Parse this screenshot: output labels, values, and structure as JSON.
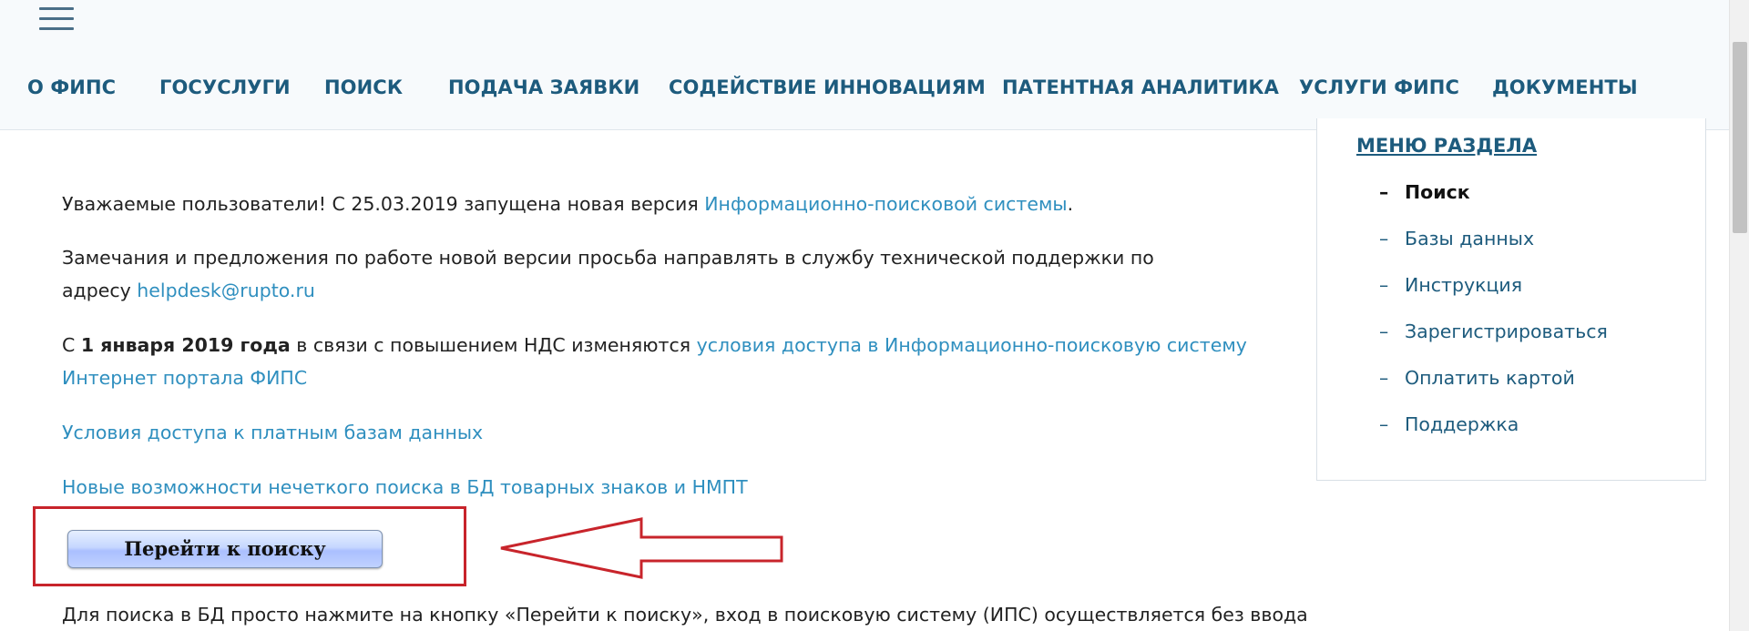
{
  "header": {
    "nav": [
      "О ФИПС",
      "ГОСУСЛУГИ",
      "ПОИСК",
      "ПОДАЧА ЗАЯВКИ",
      "СОДЕЙСТВИЕ ИННОВАЦИЯМ",
      "ПАТЕНТНАЯ АНАЛИТИКА",
      "УСЛУГИ ФИПС",
      "ДОКУМЕНТЫ"
    ]
  },
  "content": {
    "p1_text": "Уважаемые пользователи! С 25.03.2019 запущена новая версия ",
    "p1_link": "Информационно-поисковой системы",
    "p1_end": ".",
    "p2_line1": "Замечания и предложения по работе новой версии просьба направлять в службу технической поддержки по",
    "p2_line2_text": "адресу ",
    "p2_link": "helpdesk@rupto.ru",
    "p3_prefix": "С ",
    "p3_bold": "1 января 2019 года",
    "p3_mid": " в связи с повышением НДС изменяются ",
    "p3_link_line1": "условия доступа в Информационно-поисковую систему",
    "p3_link_line2": "Интернет портала ФИПС",
    "link_paid": "Условия доступа к платным базам данных",
    "link_fuzzy": "Новые возможности нечеткого поиска в БД товарных знаков и НМПТ",
    "search_button": "Перейти к поиску",
    "bottom_text": "Для поиска в БД просто нажмите на кнопку «Перейти к поиску», вход в поисковую систему (ИПС) осуществляется без ввода"
  },
  "side_menu": {
    "title": "МЕНЮ РАЗДЕЛА",
    "dash": "–",
    "items": [
      "Поиск",
      "Базы данных",
      "Инструкция",
      "Зарегистрироваться",
      "Оплатить картой",
      "Поддержка"
    ]
  },
  "colors": {
    "nav_text": "#1d5b7d",
    "link": "#2f8fbf",
    "highlight": "#c8242b",
    "header_bg": "#f7fafc"
  },
  "icons": {
    "menu": "hamburger-icon",
    "arrow": "left-arrow-annotation"
  }
}
